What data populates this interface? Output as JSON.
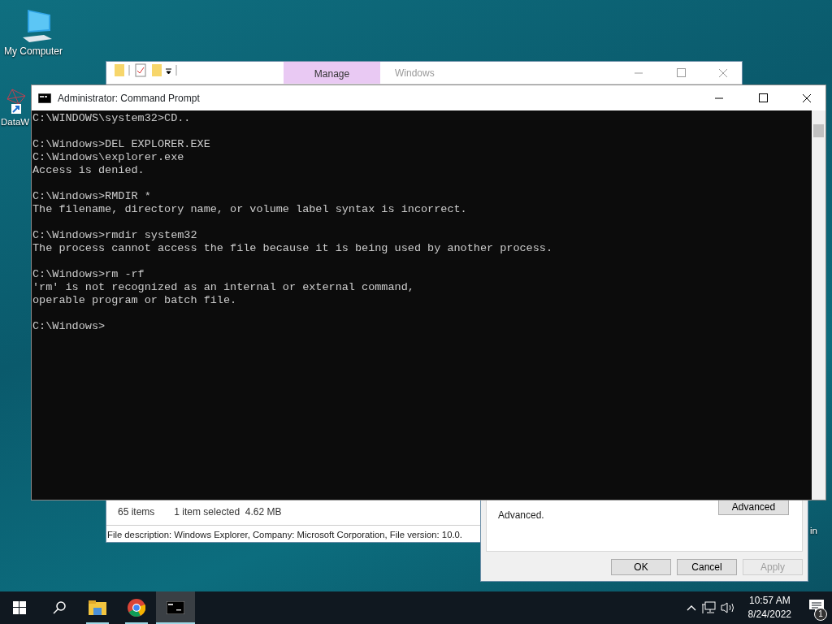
{
  "desktop_icons": [
    {
      "kind": "computer",
      "label": "My Computer"
    },
    {
      "kind": "shortcut",
      "label": "DataW"
    },
    {
      "kind": "hidden",
      "label": "in"
    }
  ],
  "explorer": {
    "context_tab": {
      "label": "Manage",
      "selected": true
    },
    "title": "Windows",
    "status_count": "65 items",
    "status_selection": "1 item selected  4.62 MB",
    "file_description": "File description: Windows Explorer, Company: Microsoft Corporation, File version: 10.0."
  },
  "properties_dialog": {
    "note": "Advanced.",
    "advanced_button": "Advanced",
    "buttons": [
      {
        "label": "OK",
        "disabled": false
      },
      {
        "label": "Cancel",
        "disabled": false
      },
      {
        "label": "Apply",
        "disabled": true
      }
    ]
  },
  "cmd_window": {
    "title": "Administrator: Command Prompt",
    "blocks": [
      [
        "C:\\WINDOWS\\system32>CD.."
      ],
      [
        "C:\\Windows>DEL EXPLORER.EXE",
        "C:\\Windows\\explorer.exe",
        "Access is denied."
      ],
      [
        "C:\\Windows>RMDIR *",
        "The filename, directory name, or volume label syntax is incorrect."
      ],
      [
        "C:\\Windows>rmdir system32",
        "The process cannot access the file because it is being used by another process."
      ],
      [
        "C:\\Windows>rm -rf",
        "'rm' is not recognized as an internal or external command,",
        "operable program or batch file."
      ],
      [
        "C:\\Windows>"
      ]
    ]
  },
  "taskbar": {
    "items": [
      {
        "kind": "start",
        "running": false,
        "selected": false
      },
      {
        "kind": "search",
        "running": false,
        "selected": false
      },
      {
        "kind": "explorer",
        "running": true,
        "selected": false
      },
      {
        "kind": "chrome",
        "running": true,
        "selected": false
      },
      {
        "kind": "cmd",
        "running": true,
        "selected": true
      }
    ],
    "time": "10:57 AM",
    "date": "8/24/2022",
    "notification_count": "1"
  }
}
